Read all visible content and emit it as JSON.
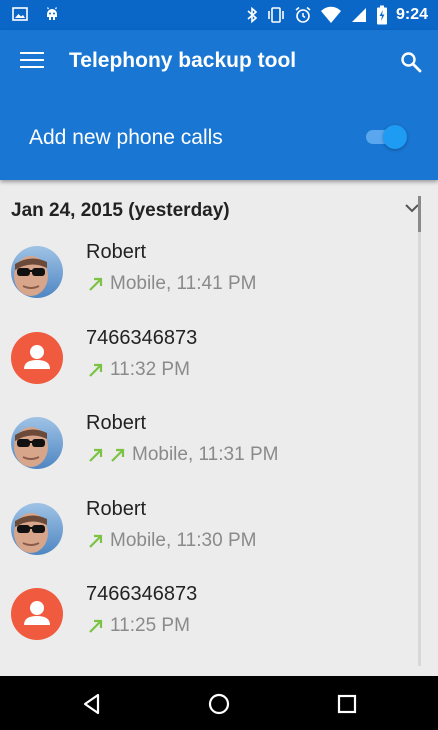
{
  "status_bar": {
    "time": "9:24",
    "left_icons": [
      "image-icon",
      "android-icon"
    ],
    "right_icons": [
      "bluetooth-icon",
      "vibrate-icon",
      "alarm-icon",
      "wifi-icon",
      "signal-icon",
      "battery-charging-icon"
    ]
  },
  "app_bar": {
    "title": "Telephony backup tool",
    "toggle_label": "Add new phone calls",
    "toggle_on": true,
    "colors": {
      "status": "#0b67c7",
      "toolbar": "#1976d2",
      "accent": "#1e9bf3"
    }
  },
  "list": {
    "date_header": "Jan 24, 2015 (yesterday)",
    "calls": [
      {
        "name": "Robert",
        "detail": "Mobile, 11:41 PM",
        "arrows": 1,
        "avatar": "photo"
      },
      {
        "name": "7466346873",
        "detail": "11:32 PM",
        "arrows": 1,
        "avatar": "contact"
      },
      {
        "name": "Robert",
        "detail": "Mobile, 11:31 PM",
        "arrows": 2,
        "avatar": "photo"
      },
      {
        "name": "Robert",
        "detail": "Mobile, 11:30 PM",
        "arrows": 1,
        "avatar": "photo"
      },
      {
        "name": "7466346873",
        "detail": "11:25 PM",
        "arrows": 1,
        "avatar": "contact"
      }
    ],
    "outgoing_arrow_color": "#7cc243"
  },
  "nav_bar": {
    "buttons": [
      "back-icon",
      "home-icon",
      "recents-icon"
    ]
  }
}
